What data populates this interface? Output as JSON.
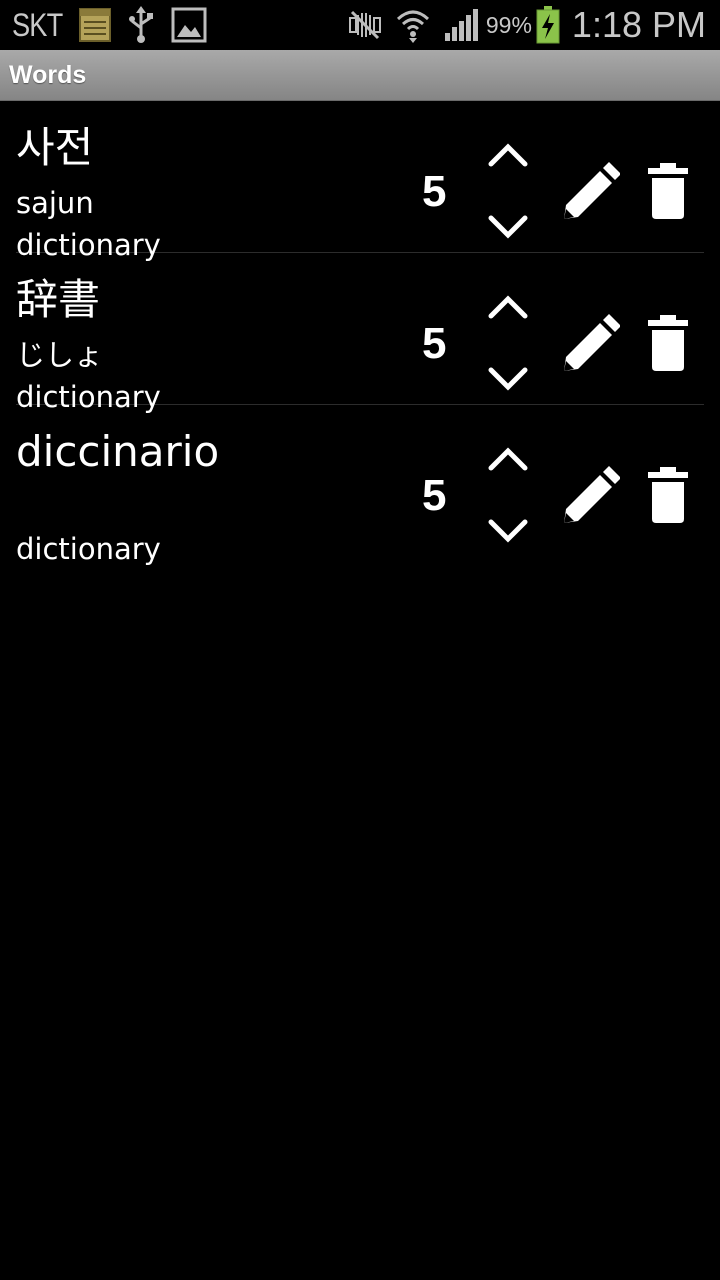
{
  "status_bar": {
    "carrier": "SKT",
    "battery_percent": "99%",
    "time": "1:18 PM",
    "icons": [
      "notes-icon",
      "usb-icon",
      "gallery-icon",
      "mute-icon",
      "wifi-icon",
      "signal-icon",
      "battery-charging-icon"
    ]
  },
  "title_bar": {
    "title": "Words"
  },
  "words": [
    {
      "word": "사전",
      "reading": "sajun",
      "meaning": "dictionary",
      "score": "5"
    },
    {
      "word": "辞書",
      "reading": "じしょ",
      "meaning": "dictionary",
      "score": "5"
    },
    {
      "word": "diccinario",
      "reading": "",
      "meaning": "dictionary",
      "score": "5"
    }
  ],
  "colors": {
    "background": "#000000",
    "titlebar_top": "#a9a9a9",
    "titlebar_bottom": "#858585",
    "text": "#ffffff",
    "status_text": "#c8c8c8",
    "battery_green": "#8bc34a"
  }
}
